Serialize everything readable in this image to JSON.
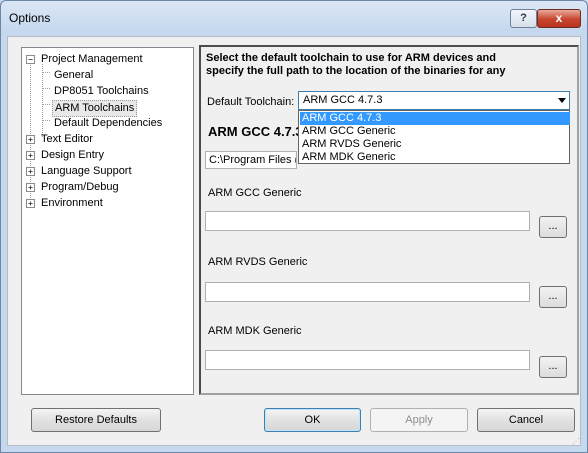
{
  "window": {
    "title": "Options",
    "help_label": "?",
    "close_label": "x"
  },
  "tree": {
    "nodes": [
      {
        "label": "Project Management",
        "expander": "−"
      },
      {
        "label": "General"
      },
      {
        "label": "DP8051 Toolchains"
      },
      {
        "label": "ARM Toolchains"
      },
      {
        "label": "Default Dependencies"
      },
      {
        "label": "Text Editor",
        "expander": "+"
      },
      {
        "label": "Design Entry",
        "expander": "+"
      },
      {
        "label": "Language Support",
        "expander": "+"
      },
      {
        "label": "Program/Debug",
        "expander": "+"
      },
      {
        "label": "Environment",
        "expander": "+"
      }
    ]
  },
  "panel": {
    "heading_line1": "Select the default toolchain to use for ARM devices and",
    "heading_line2": "specify the full path to the location of the binaries for any",
    "default_toolchain_label": "Default Toolchain:",
    "selected_toolchain": "ARM GCC 4.7.3",
    "dropdown_options": [
      "ARM GCC 4.7.3",
      "ARM GCC Generic",
      "ARM RVDS Generic",
      "ARM MDK Generic"
    ],
    "current_toolchain_heading": "ARM GCC 4.7.3",
    "path_value": "C:\\Program Files (x",
    "sections": [
      {
        "label": "ARM GCC Generic",
        "value": "",
        "browse": "..."
      },
      {
        "label": "ARM RVDS Generic",
        "value": "",
        "browse": "..."
      },
      {
        "label": "ARM MDK Generic",
        "value": "",
        "browse": "..."
      }
    ]
  },
  "buttons": {
    "restore": "Restore Defaults",
    "ok": "OK",
    "apply": "Apply",
    "cancel": "Cancel"
  },
  "colors": {
    "selection": "#3399ff",
    "close": "#c7442e"
  }
}
